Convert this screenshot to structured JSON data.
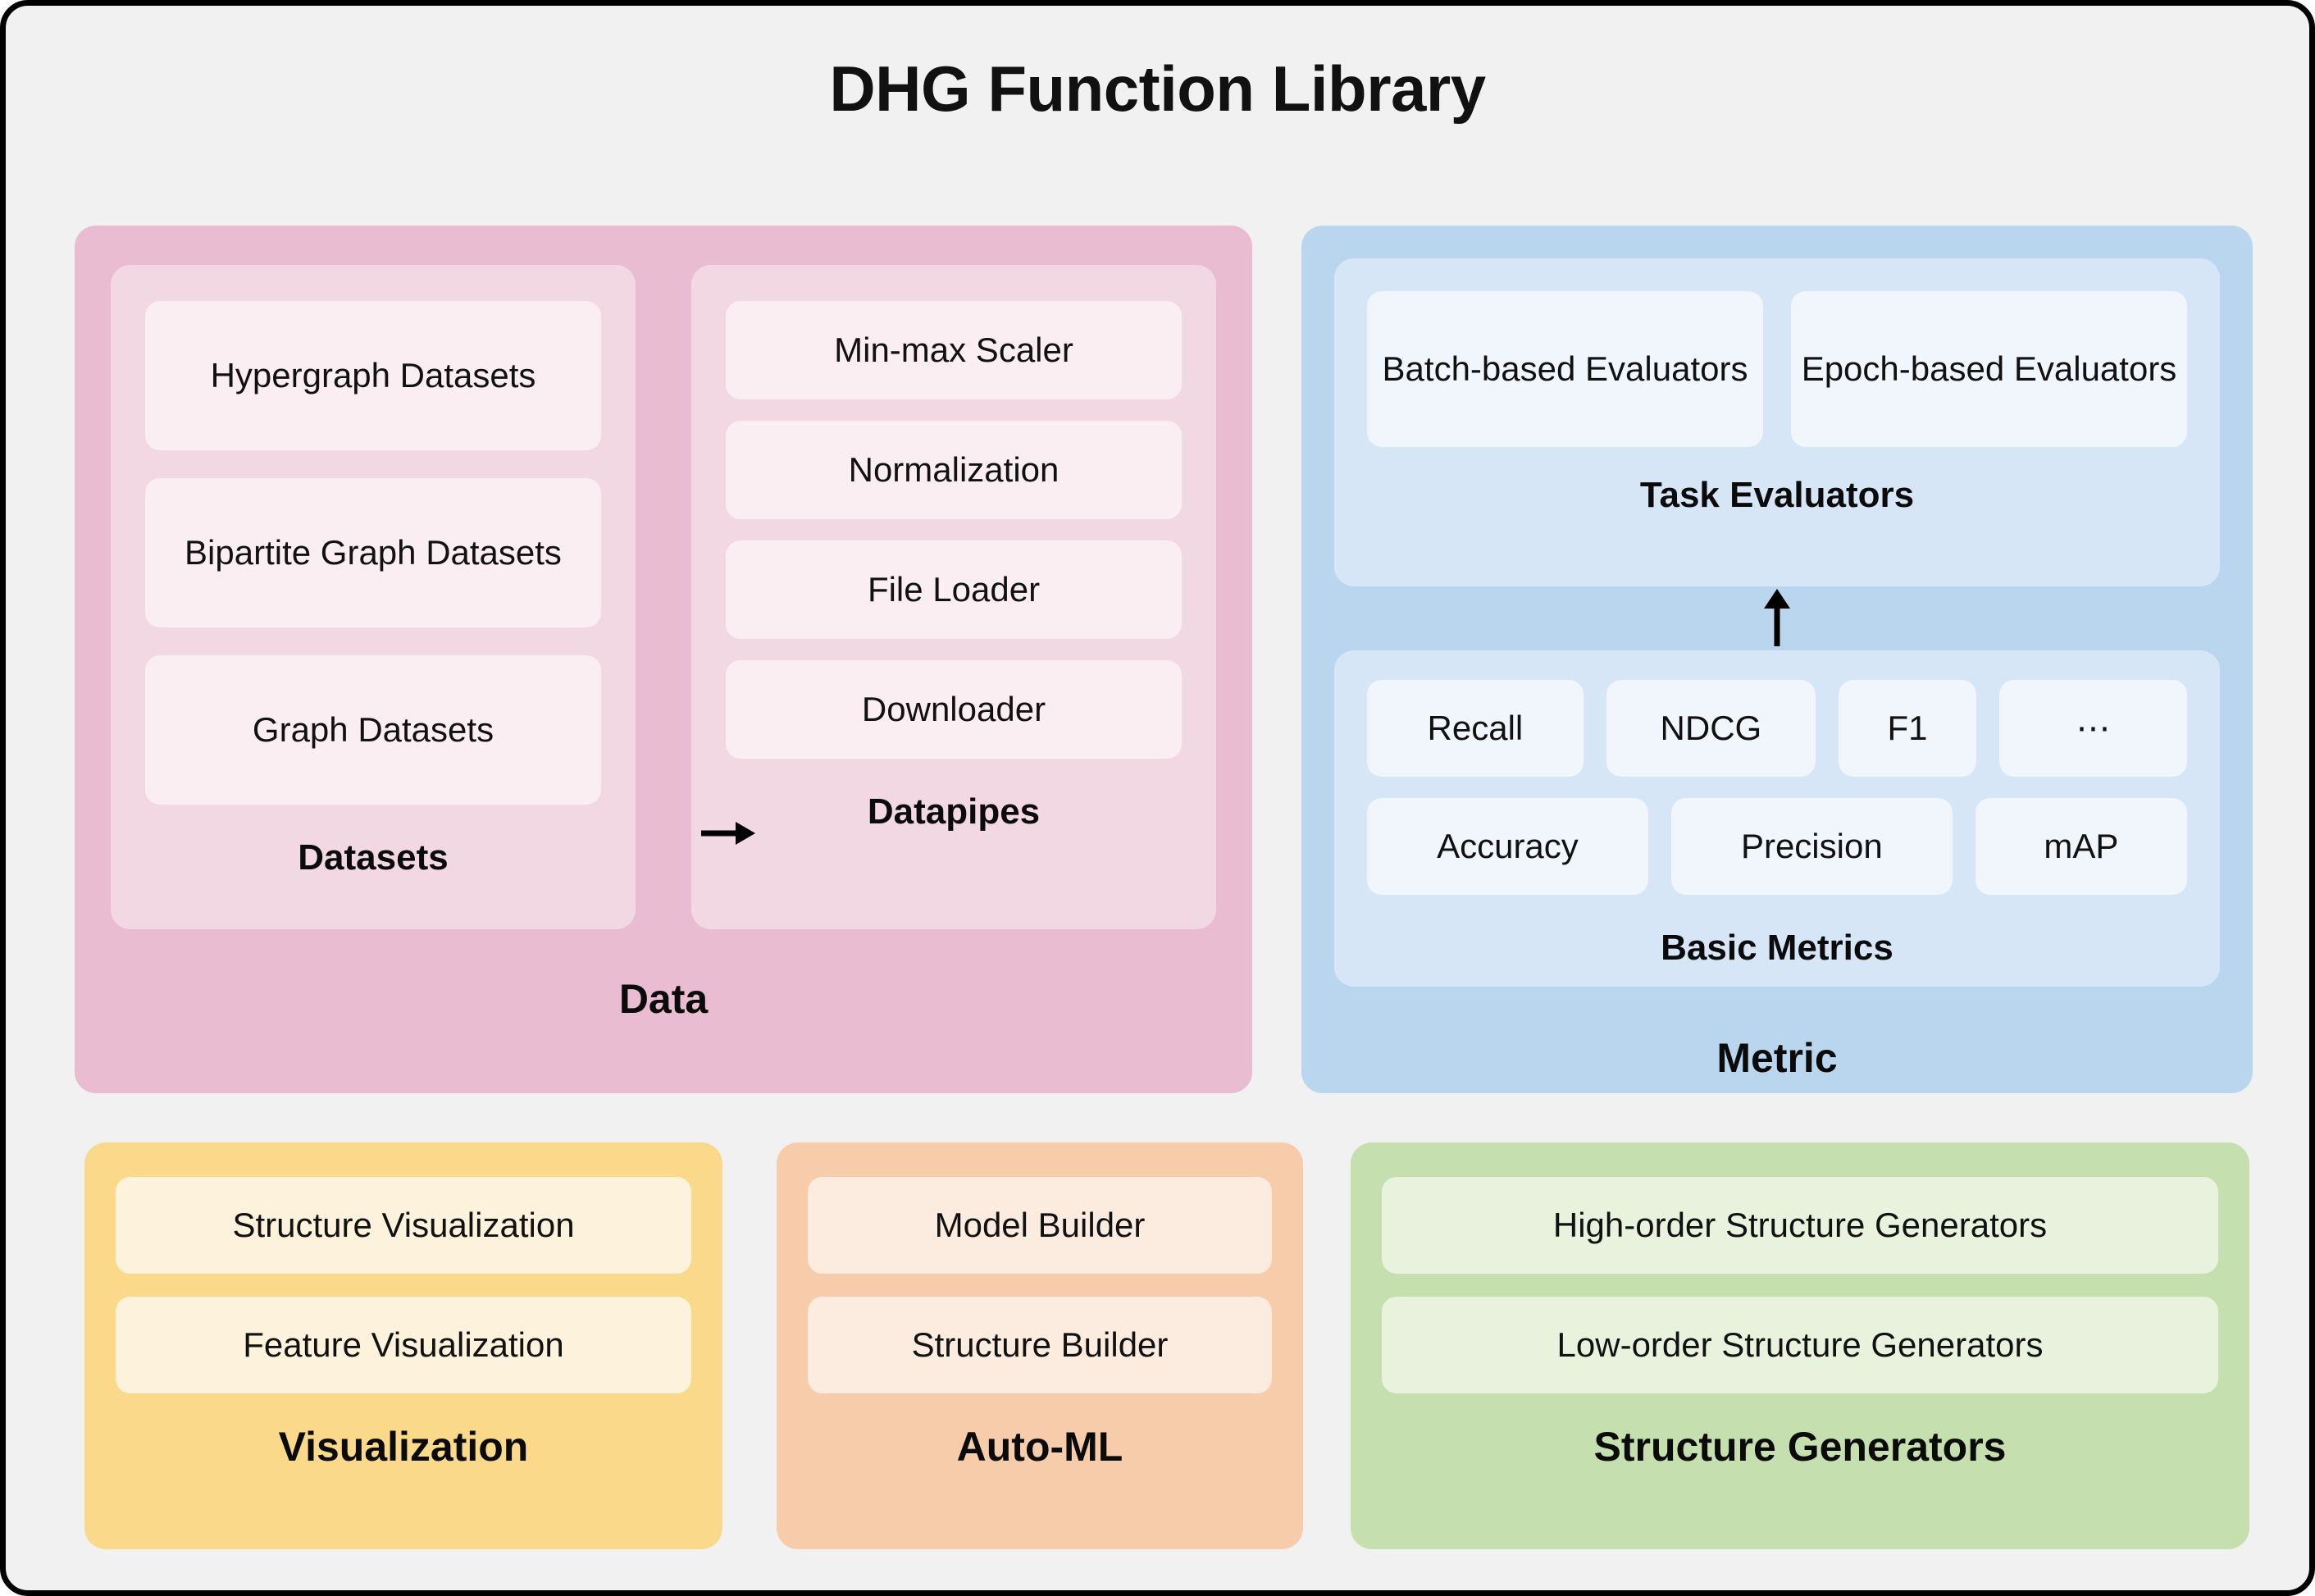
{
  "title": "DHG Function Library",
  "colors": {
    "background": "#f1f1f1",
    "border": "#000000",
    "data": "#e9bcd1",
    "data_sub": "#f2d8e2",
    "data_chip": "#fbeef3",
    "metric": "#bad6ee",
    "metric_sub": "#d6e6f6",
    "metric_chip": "#f1f5fc",
    "visualization": "#fbd98a",
    "visualization_chip": "#fdf2dc",
    "automl": "#f7ccab",
    "automl_chip": "#fcebdf",
    "generators": "#c5dfae",
    "generators_chip": "#e8f2dd"
  },
  "data": {
    "title": "Data",
    "arrow_icon": "arrow-right-icon",
    "datasets": {
      "title": "Datasets",
      "items": [
        "Hypergraph Datasets",
        "Bipartite Graph Datasets",
        "Graph Datasets"
      ]
    },
    "datapipes": {
      "title": "Datapipes",
      "items": [
        "Min-max Scaler",
        "Normalization",
        "File Loader",
        "Downloader"
      ]
    }
  },
  "metric": {
    "title": "Metric",
    "arrow_icon": "arrow-up-icon",
    "task_evaluators": {
      "title": "Task Evaluators",
      "items": [
        "Batch-based Evaluators",
        "Epoch-based Evaluators"
      ]
    },
    "basic_metrics": {
      "title": "Basic Metrics",
      "row1": [
        "Recall",
        "NDCG",
        "F1",
        "⋯"
      ],
      "row2": [
        "Accuracy",
        "Precision",
        "mAP"
      ]
    }
  },
  "visualization": {
    "title": "Visualization",
    "items": [
      "Structure Visualization",
      "Feature Visualization"
    ]
  },
  "automl": {
    "title": "Auto-ML",
    "items": [
      "Model Builder",
      "Structure Builder"
    ]
  },
  "generators": {
    "title": "Structure Generators",
    "items": [
      "High-order Structure Generators",
      "Low-order Structure Generators"
    ]
  }
}
